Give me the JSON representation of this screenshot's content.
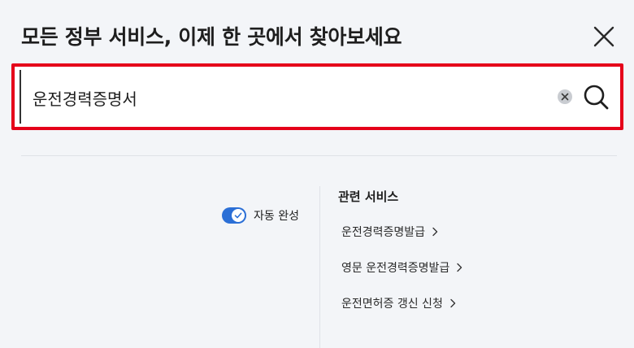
{
  "header": {
    "title": "모든 정부 서비스, 이제 한 곳에서 찾아보세요"
  },
  "search": {
    "value": "운전경력증명서",
    "placeholder": ""
  },
  "autocomplete": {
    "label": "자동 완성",
    "enabled": true
  },
  "related": {
    "title": "관련 서비스",
    "items": [
      {
        "label": "운전경력증명발급"
      },
      {
        "label": "영문 운전경력증명발급"
      },
      {
        "label": "운전면허증 갱신 신청"
      }
    ]
  },
  "icons": {
    "close": "close-icon",
    "clear": "clear-icon",
    "search": "search-icon",
    "check": "check-icon",
    "chevron": "chevron-right-icon"
  },
  "colors": {
    "accent": "#2b6fd6",
    "highlight_border": "#e5001a",
    "background": "#f3f5f8"
  }
}
